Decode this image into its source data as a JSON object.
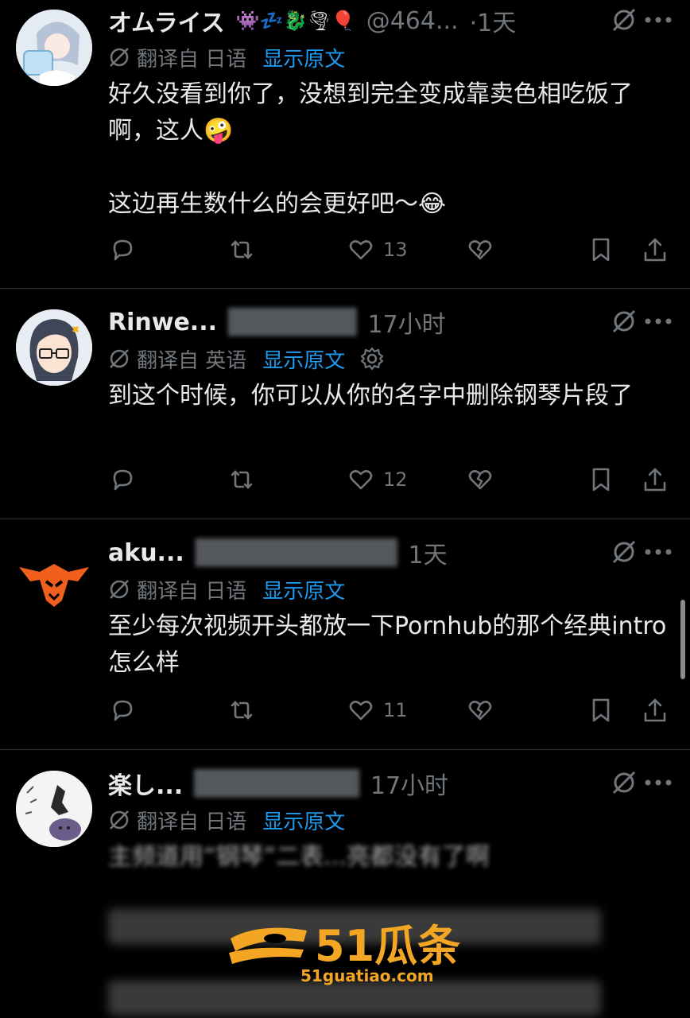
{
  "colors": {
    "background": "#000000",
    "text": "#e7e9ea",
    "muted": "#71767b",
    "link": "#1d9bf0",
    "divider": "#2f3336",
    "watermark": "#f2a623"
  },
  "posts": [
    {
      "name": "オムライス",
      "emojis": "👾💤🐉🌪🎈",
      "handle": "@464...",
      "time": "·1天",
      "translate_label": "翻译自 日语",
      "show_original": "显示原文",
      "text": "好久没看到你了，没想到完全变成靠卖色相吃饭了啊，这人🤪\n\n这边再生数什么的会更好吧～😂",
      "likes": "13",
      "avatar_icon": "anime-girl-avatar"
    },
    {
      "name": "Rinwe...",
      "time": "17小时",
      "translate_label": "翻译自 英语",
      "show_original": "显示原文",
      "text": "到这个时候，你可以从你的名字中删除钢琴片段了",
      "likes": "12",
      "avatar_icon": "glasses-avatar"
    },
    {
      "name": "aku...",
      "time": "1天",
      "translate_label": "翻译自 日语",
      "show_original": "显示原文",
      "text": "至少每次视频开头都放一下Pornhub的那个经典intro怎么样",
      "likes": "11",
      "avatar_icon": "wolf-logo-avatar"
    },
    {
      "name": "楽し...",
      "time": "17小时",
      "translate_label": "翻译自 日语",
      "show_original": "显示原文",
      "text": "主频道用“钢琴”二表...亮都没有了啊",
      "avatar_icon": "sketch-avatar"
    }
  ],
  "watermark": {
    "brand": "51瓜条",
    "url": "51guatiao.com"
  }
}
